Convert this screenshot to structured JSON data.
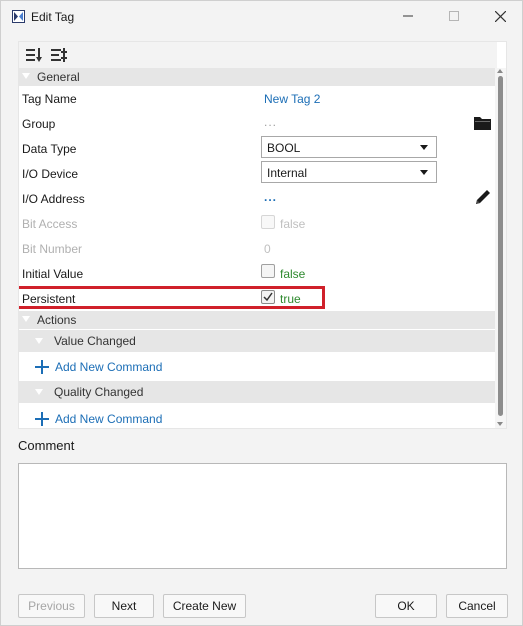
{
  "window": {
    "title": "Edit Tag",
    "controls": [
      "minimize",
      "maximize",
      "close"
    ]
  },
  "toolbar": {
    "icons": [
      "sort-icon",
      "sort-filter-icon"
    ]
  },
  "sections": {
    "general": "General",
    "actions": "Actions",
    "value_changed": "Value Changed",
    "quality_changed": "Quality Changed"
  },
  "properties": {
    "tag_name": {
      "label": "Tag Name",
      "value": "New Tag 2"
    },
    "group": {
      "label": "Group",
      "value": "..."
    },
    "data_type": {
      "label": "Data Type",
      "value": "BOOL"
    },
    "io_device": {
      "label": "I/O Device",
      "value": "Internal"
    },
    "io_address": {
      "label": "I/O Address",
      "value": "..."
    },
    "bit_access": {
      "label": "Bit Access",
      "value": "false",
      "checked": false,
      "enabled": false
    },
    "bit_number": {
      "label": "Bit Number",
      "value": "0",
      "enabled": false
    },
    "initial_value": {
      "label": "Initial Value",
      "value": "false",
      "checked": false
    },
    "persistent": {
      "label": "Persistent",
      "value": "true",
      "checked": true
    }
  },
  "actions": {
    "add_command_1": "Add New Command",
    "add_command_2": "Add New Command"
  },
  "comment": {
    "label": "Comment",
    "value": ""
  },
  "buttons": {
    "previous": "Previous",
    "next": "Next",
    "create_new": "Create New",
    "ok": "OK",
    "cancel": "Cancel"
  },
  "colors": {
    "link": "#1c6eb6",
    "value_green": "#2f8a2f",
    "highlight_border": "#d0202a"
  }
}
